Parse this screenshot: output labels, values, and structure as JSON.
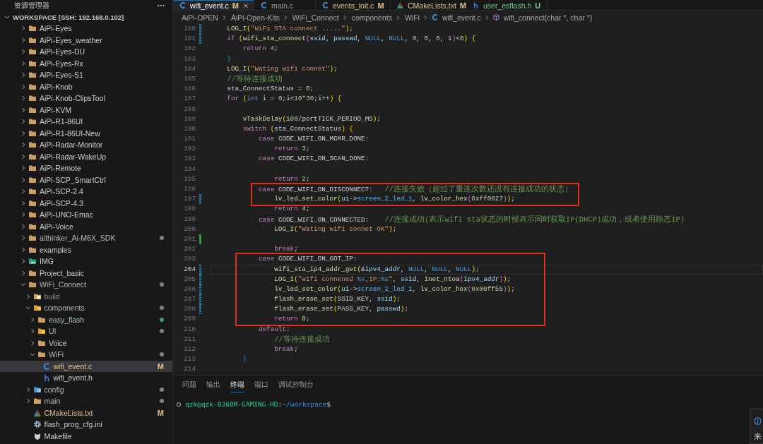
{
  "explorer": {
    "title": "资源管理器",
    "workspace": {
      "label": "WORKSPACE [SSH: 192.168.0.102]",
      "expanded": true
    },
    "tree": [
      {
        "label": "AiPi-Eyes",
        "kind": "folder",
        "expanded": false,
        "selected": false,
        "dimmed": false
      },
      {
        "label": "AiPi-Eyes_weather",
        "kind": "folder",
        "expanded": false,
        "selected": false,
        "dimmed": false
      },
      {
        "label": "AiPi-Eyes-DU",
        "kind": "folder",
        "expanded": false,
        "selected": false,
        "dimmed": false
      },
      {
        "label": "AiPi-Eyes-Rx",
        "kind": "folder",
        "expanded": false,
        "selected": false,
        "dimmed": false
      },
      {
        "label": "AiPi-Eyes-S1",
        "kind": "folder",
        "expanded": false,
        "selected": false,
        "dimmed": false
      },
      {
        "label": "AiPi-Knob",
        "kind": "folder",
        "expanded": false,
        "selected": false,
        "dimmed": false
      },
      {
        "label": "AiPi-Knob-ClipsTool",
        "kind": "folder",
        "expanded": false,
        "selected": false,
        "dimmed": false
      },
      {
        "label": "AiPi-KVM",
        "kind": "folder",
        "expanded": false,
        "selected": false,
        "dimmed": false
      },
      {
        "label": "AiPi-R1-86UI",
        "kind": "folder",
        "expanded": false,
        "selected": false,
        "dimmed": false
      },
      {
        "label": "AiPi-R1-86UI-New",
        "kind": "folder",
        "expanded": false,
        "selected": false,
        "dimmed": false
      },
      {
        "label": "AiPi-Radar-Monitor",
        "kind": "folder",
        "expanded": false,
        "selected": false,
        "dimmed": false
      },
      {
        "label": "AiPi-Radar-WakeUp",
        "kind": "folder",
        "expanded": false,
        "selected": false,
        "dimmed": false
      },
      {
        "label": "AiPi-Remote",
        "kind": "folder",
        "expanded": false,
        "selected": false,
        "dimmed": false
      },
      {
        "label": "AiPi-SCP_SmartCtrl",
        "kind": "folder",
        "expanded": false,
        "selected": false,
        "dimmed": false
      },
      {
        "label": "AiPi-SCP-2.4",
        "kind": "folder",
        "expanded": false,
        "selected": false,
        "dimmed": false
      },
      {
        "label": "AiPi-SCP-4.3",
        "kind": "folder",
        "expanded": false,
        "selected": false,
        "dimmed": false
      },
      {
        "label": "AiPi-UNO-Emac",
        "kind": "folder",
        "expanded": false,
        "selected": false,
        "dimmed": false
      },
      {
        "label": "AiPi-Voice",
        "kind": "folder",
        "expanded": false,
        "selected": false,
        "dimmed": false
      },
      {
        "label": "aithinker_Ai-M6X_SDK",
        "kind": "folder",
        "expanded": false,
        "selected": false,
        "dimmed": false,
        "color": "#8a7f6e"
      },
      {
        "label": "examples",
        "kind": "folder",
        "expanded": false,
        "selected": false,
        "dimmed": false
      },
      {
        "label": "IMG",
        "kind": "image-folder",
        "expanded": false,
        "selected": false,
        "dimmed": false
      },
      {
        "label": "Project_basic",
        "kind": "folder",
        "expanded": false,
        "selected": false,
        "dimmed": false
      },
      {
        "label": "WiFi_Connect",
        "kind": "folder",
        "expanded": true,
        "selected": false,
        "dimmed": false,
        "color": "#8a7f6e",
        "children": [
          {
            "label": "build",
            "kind": "build-folder",
            "expanded": false,
            "selected": false,
            "dimmed": true
          },
          {
            "label": "components",
            "kind": "component-folder",
            "expanded": true,
            "selected": false,
            "dimmed": false,
            "color": "#8a7f6e",
            "children": [
              {
                "label": "easy_flash",
                "kind": "folder",
                "expanded": false,
                "selected": false,
                "dimmed": false,
                "color": "#3f9d68"
              },
              {
                "label": "UI",
                "kind": "component-folder",
                "expanded": false,
                "selected": false,
                "dimmed": false,
                "color": "#8a7f6e"
              },
              {
                "label": "Voice",
                "kind": "folder",
                "expanded": false,
                "selected": false,
                "dimmed": false
              },
              {
                "label": "WiFi",
                "kind": "folder",
                "expanded": true,
                "selected": false,
                "dimmed": false,
                "color": "#8a7f6e",
                "children": [
                  {
                    "label": "wifi_event.c",
                    "kind": "c-file",
                    "selected": true,
                    "dimmed": false,
                    "badge": "M",
                    "color": "#e2c08d"
                  },
                  {
                    "label": "wifi_event.h",
                    "kind": "h-file",
                    "selected": false,
                    "dimmed": false
                  }
                ]
              }
            ]
          },
          {
            "label": "config",
            "kind": "config-folder",
            "expanded": false,
            "selected": false,
            "dimmed": false,
            "color": "#8a7f6e"
          },
          {
            "label": "main",
            "kind": "folder",
            "expanded": false,
            "selected": false,
            "dimmed": false,
            "color": "#8a7f6e"
          },
          {
            "label": "CMakeLists.txt",
            "kind": "cmake-file",
            "selected": false,
            "dimmed": false,
            "badge": "M",
            "color": "#e2c08d"
          },
          {
            "label": "flash_prog_cfg.ini",
            "kind": "settings-file",
            "selected": false,
            "dimmed": false
          },
          {
            "label": "Makefile",
            "kind": "make-file",
            "selected": false,
            "dimmed": false
          }
        ]
      }
    ]
  },
  "tabs": [
    {
      "label": "wifi_event.c",
      "kind": "c-file",
      "badge": "M",
      "color": "#e2c08d",
      "selected": true
    },
    {
      "label": "main.c",
      "kind": "c-file",
      "selected": false
    },
    {
      "label": "events_init.c",
      "kind": "c-file",
      "badge": "M",
      "color": "#e2c08d",
      "selected": false
    },
    {
      "label": "CMakeLists.txt",
      "kind": "cmake-file",
      "badge": "M",
      "color": "#e2c08d",
      "selected": false
    },
    {
      "label": "user_esflash.h",
      "kind": "h-file",
      "badge": "U",
      "color": "#73c991",
      "selected": false
    }
  ],
  "breadcrumb": [
    {
      "label": "AiPi-OPEN",
      "kind": "folder"
    },
    {
      "label": "AiPi-Open-Kits",
      "kind": "folder"
    },
    {
      "label": "WiFi_Connect",
      "kind": "folder"
    },
    {
      "label": "components",
      "kind": "folder"
    },
    {
      "label": "WiFi",
      "kind": "folder"
    },
    {
      "label": "wifi_event.c",
      "kind": "c-file"
    },
    {
      "label": "wifi_connect(char *, char *)",
      "kind": "method"
    }
  ],
  "code": {
    "lines": [
      {
        "number": "180",
        "kind": "modified",
        "boxed": false,
        "current": false,
        "text": "    LOG_I(\"WiFi STA connect .....\");"
      },
      {
        "number": "181",
        "kind": "modified",
        "boxed": false,
        "current": false,
        "text": "    if (wifi_sta_connect(ssid, passwd, NULL, NULL, 0, 0, 0, 1)<0) {"
      },
      {
        "number": "182",
        "kind": "plain",
        "boxed": false,
        "current": false,
        "text": "        return 4;"
      },
      {
        "number": "183",
        "kind": "plain",
        "boxed": false,
        "current": false,
        "text": "    }"
      },
      {
        "number": "184",
        "kind": "plain",
        "boxed": false,
        "current": false,
        "text": "    LOG_I(\"Wating wifi connet\");"
      },
      {
        "number": "185",
        "kind": "plain",
        "boxed": false,
        "current": false,
        "text": "    //等待连接成功"
      },
      {
        "number": "186",
        "kind": "plain",
        "boxed": false,
        "current": false,
        "text": "    sta_ConnectStatus = 0;"
      },
      {
        "number": "187",
        "kind": "plain",
        "boxed": false,
        "current": false,
        "text": "    for (int i = 0;i<10*30;i++) {"
      },
      {
        "number": "188",
        "kind": "plain",
        "boxed": false,
        "current": false
      },
      {
        "number": "189",
        "kind": "plain",
        "boxed": false,
        "current": false,
        "text": "        vTaskDelay(100/portTICK_PERIOD_MS);"
      },
      {
        "number": "190",
        "kind": "plain",
        "boxed": false,
        "current": false,
        "text": "        switch (sta_ConnectStatus) {"
      },
      {
        "number": "191",
        "kind": "plain",
        "boxed": false,
        "current": false,
        "text": "            case CODE_WIFI_ON_MGMR_DONE:"
      },
      {
        "number": "192",
        "kind": "plain",
        "boxed": false,
        "current": false,
        "text": "                return 3;"
      },
      {
        "number": "193",
        "kind": "plain",
        "boxed": false,
        "current": false,
        "text": "            case CODE_WIFI_ON_SCAN_DONE:"
      },
      {
        "number": "194",
        "kind": "plain",
        "boxed": false,
        "current": false
      },
      {
        "number": "195",
        "kind": "plain",
        "boxed": false,
        "current": false,
        "text": "                return 2;"
      },
      {
        "number": "196",
        "kind": "plain",
        "boxed": true,
        "current": false,
        "text": "            case CODE_WIFI_ON_DISCONNECT:   //连接失败（超过了重连次数还没有连接成功的状态）"
      },
      {
        "number": "197",
        "kind": "modified",
        "boxed": true,
        "current": false,
        "text": "                lv_led_set_color(ui->screen_2_led_1, lv_color_hex(0xff0027));"
      },
      {
        "number": "198",
        "kind": "plain",
        "boxed": false,
        "current": false,
        "text": "                return 4;"
      },
      {
        "number": "199",
        "kind": "plain",
        "boxed": false,
        "current": false,
        "text": "            case CODE_WIFI_ON_CONNECTED:    //连接成功(表示wifi sta状态的时候表示同时获取IP(DHCP)成功，或者使用静态IP)"
      },
      {
        "number": "200",
        "kind": "plain",
        "boxed": false,
        "current": false,
        "text": "                LOG_I(\"Wating wifi connet OK\");"
      },
      {
        "number": "201",
        "kind": "added",
        "boxed": false,
        "current": false
      },
      {
        "number": "202",
        "kind": "plain",
        "boxed": false,
        "current": false,
        "text": "                break;"
      },
      {
        "number": "203",
        "kind": "plain",
        "boxed": true,
        "current": false,
        "text": "            case CODE_WIFI_ON_GOT_IP:"
      },
      {
        "number": "204",
        "kind": "modified",
        "boxed": true,
        "current": true,
        "text": "                wifi_sta_ip4_addr_get(&ipv4_addr, NULL, NULL, NULL);"
      },
      {
        "number": "205",
        "kind": "modified",
        "boxed": true,
        "current": false,
        "text": "                LOG_I(\"wifi connened %s,IP:%s\", ssid, inet_ntoa(ipv4_addr));"
      },
      {
        "number": "206",
        "kind": "modified",
        "boxed": true,
        "current": false,
        "text": "                lv_led_set_color(ui->screen_2_led_1, lv_color_hex(0x00ff55));"
      },
      {
        "number": "207",
        "kind": "modified",
        "boxed": true,
        "current": false,
        "text": "                flash_erase_set(SSID_KEY, ssid);"
      },
      {
        "number": "208",
        "kind": "modified",
        "boxed": true,
        "current": false,
        "text": "                flash_erase_set(PASS_KEY, passwd);"
      },
      {
        "number": "209",
        "kind": "plain",
        "boxed": true,
        "current": false,
        "text": "                return 0;"
      },
      {
        "number": "210",
        "kind": "plain",
        "boxed": false,
        "current": false,
        "text": "            default:"
      },
      {
        "number": "211",
        "kind": "plain",
        "boxed": false,
        "current": false,
        "text": "                //等待连接成功"
      },
      {
        "number": "212",
        "kind": "plain",
        "boxed": false,
        "current": false,
        "text": "                break;"
      },
      {
        "number": "213",
        "kind": "plain",
        "boxed": false,
        "current": false,
        "text": "        }"
      },
      {
        "number": "214",
        "kind": "plain",
        "boxed": false,
        "current": false
      }
    ]
  },
  "panel": {
    "tabs": [
      {
        "label": "问题",
        "selected": false
      },
      {
        "label": "输出",
        "selected": false
      },
      {
        "label": "终端",
        "selected": true
      },
      {
        "label": "端口",
        "selected": false
      },
      {
        "label": "调试控制台",
        "selected": false
      }
    ],
    "terminal": {
      "user_host": "qzk@qzk-B360M-GAMING-HD",
      "separator": ":",
      "path": "~/workspace",
      "prompt": "$"
    }
  },
  "notification": {
    "text": "来"
  }
}
